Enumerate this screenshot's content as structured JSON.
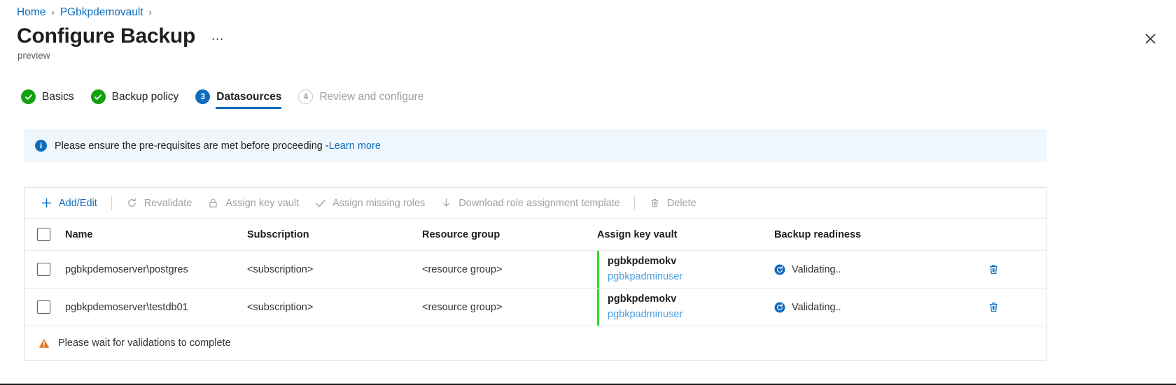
{
  "breadcrumb": {
    "items": [
      {
        "label": "Home"
      },
      {
        "label": "PGbkpdemovault"
      }
    ],
    "separator": "›"
  },
  "header": {
    "title": "Configure Backup",
    "ellipsis": "…",
    "preview_tag": "preview",
    "close_label": "Close",
    "close_icon": "close-icon"
  },
  "wizard": {
    "steps": [
      {
        "num": "1",
        "label": "Basics",
        "state": "done",
        "icon": "check-circle-icon"
      },
      {
        "num": "2",
        "label": "Backup policy",
        "state": "done",
        "icon": "check-circle-icon"
      },
      {
        "num": "3",
        "label": "Datasources",
        "state": "active",
        "icon": "step-number-badge"
      },
      {
        "num": "4",
        "label": "Review and configure",
        "state": "disabled",
        "icon": "step-number-badge"
      }
    ]
  },
  "info_banner": {
    "icon": "info-icon",
    "text": "Please ensure the pre-requisites are met before proceeding - ",
    "link_label": "Learn more"
  },
  "toolbar": {
    "commands": [
      {
        "label": "Add/Edit",
        "icon": "plus-icon",
        "enabled": true
      },
      {
        "label": "Revalidate",
        "icon": "refresh-icon",
        "enabled": false
      },
      {
        "label": "Assign key vault",
        "icon": "lock-icon",
        "enabled": false
      },
      {
        "label": "Assign missing roles",
        "icon": "check-icon",
        "enabled": false
      },
      {
        "label": "Download role assignment template",
        "icon": "download-icon",
        "enabled": false
      },
      {
        "label": "Delete",
        "icon": "trash-icon",
        "enabled": false
      }
    ]
  },
  "table": {
    "select_all_name": "select-all-checkbox",
    "columns": [
      "Name",
      "Subscription",
      "Resource group",
      "Assign key vault",
      "Backup readiness"
    ],
    "rows": [
      {
        "name": "pgbkpdemoserver\\postgres",
        "subscription": "<subscription>",
        "resource_group": "<resource group>",
        "key_vault": "pgbkpdemokv",
        "key_vault_user": "pgbkpadminuser",
        "readiness": "Validating..",
        "readiness_icon": "sync-icon",
        "delete_icon": "trash-icon"
      },
      {
        "name": "pgbkpdemoserver\\testdb01",
        "subscription": "<subscription>",
        "resource_group": "<resource group>",
        "key_vault": "pgbkpdemokv",
        "key_vault_user": "pgbkpadminuser",
        "readiness": "Validating..",
        "readiness_icon": "sync-icon",
        "delete_icon": "trash-icon"
      }
    ]
  },
  "footer": {
    "warning_icon": "warning-triangle-icon",
    "warning_text": "Please wait for validations to complete"
  },
  "colors": {
    "accent_blue": "#0f6cbd",
    "link_blue": "#4a9fe0",
    "success_green": "#13a10e",
    "keyvault_bar_green": "#2fdb2f",
    "warning_orange": "#e8761b",
    "info_bg": "#eff6fc",
    "border": "#e1dfdd"
  }
}
